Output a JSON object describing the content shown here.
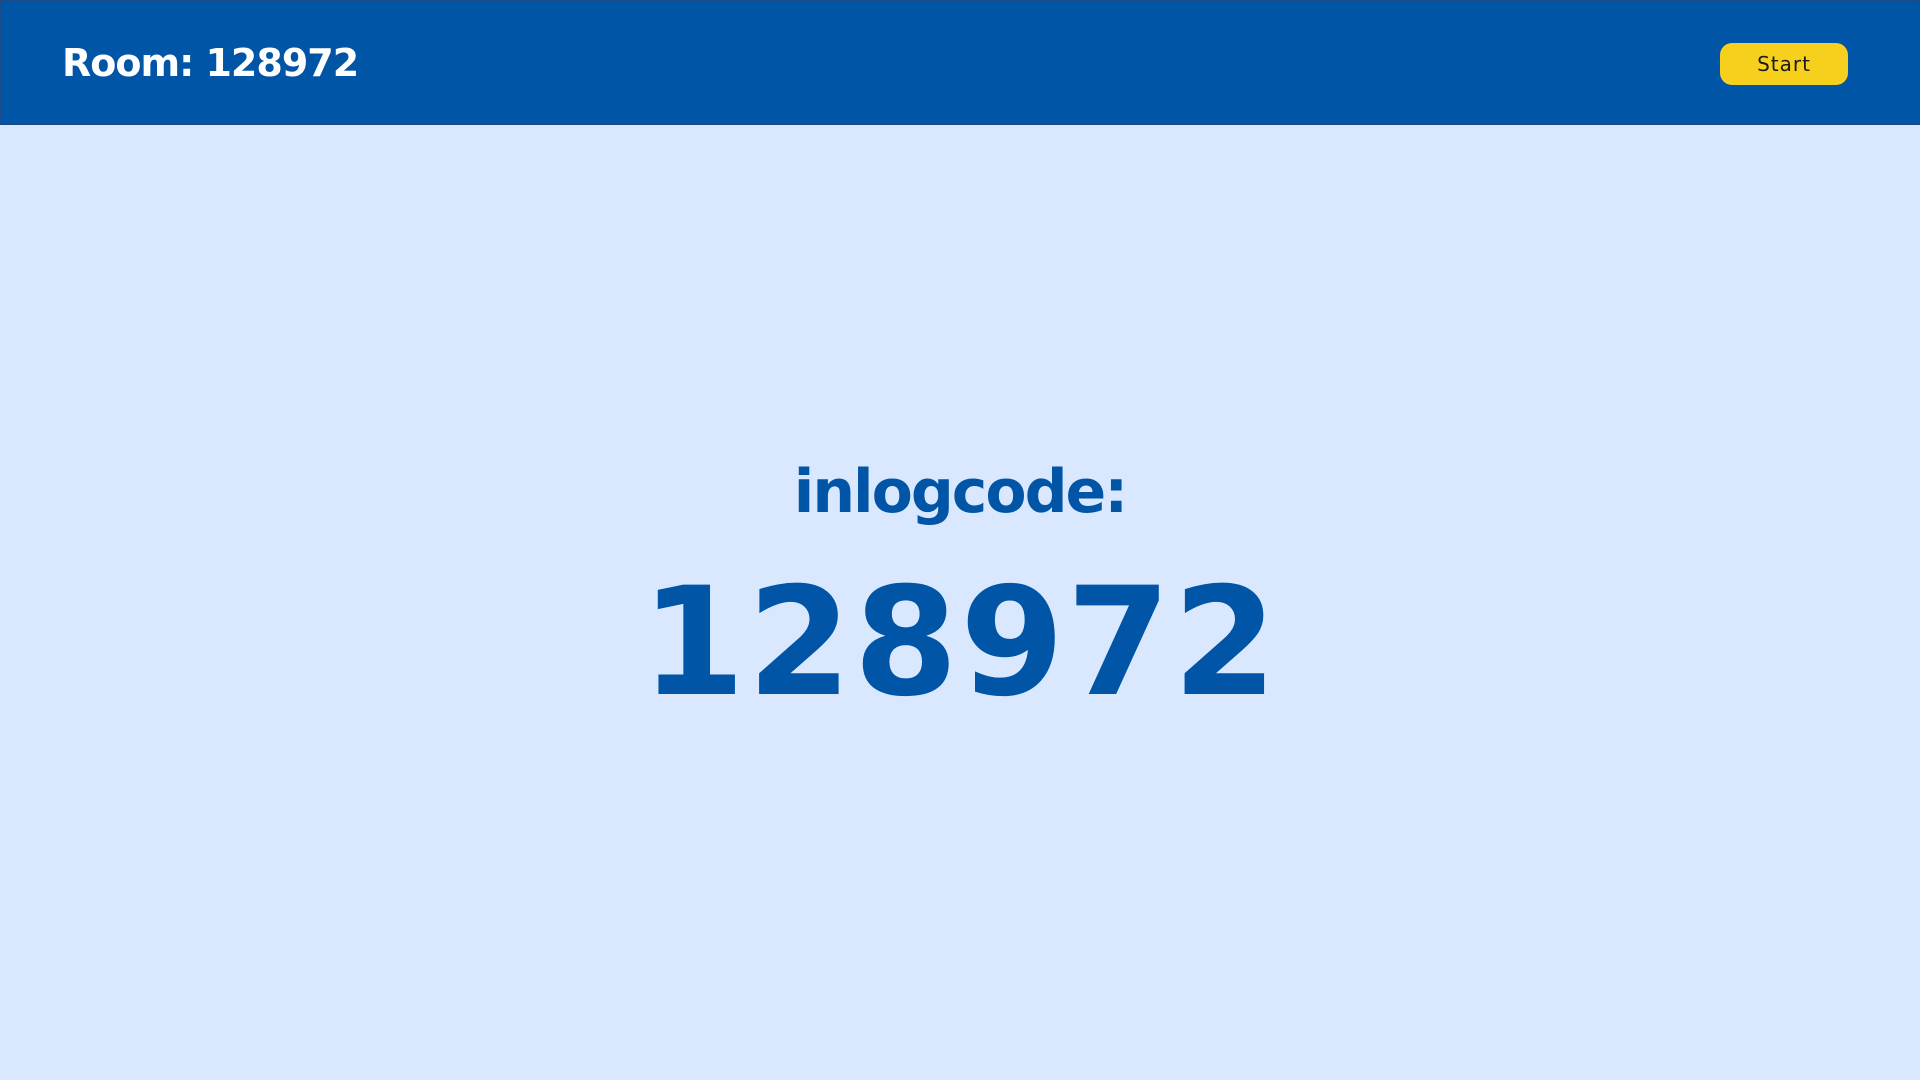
{
  "header": {
    "title": "Room: 128972",
    "start_label": "Start"
  },
  "main": {
    "login_label": "inlogcode:",
    "login_code": "128972"
  },
  "colors": {
    "header_background": "#0055a6",
    "page_background": "#dae8ff",
    "accent_text": "#0055a6",
    "start_button": "#f6d01d"
  }
}
